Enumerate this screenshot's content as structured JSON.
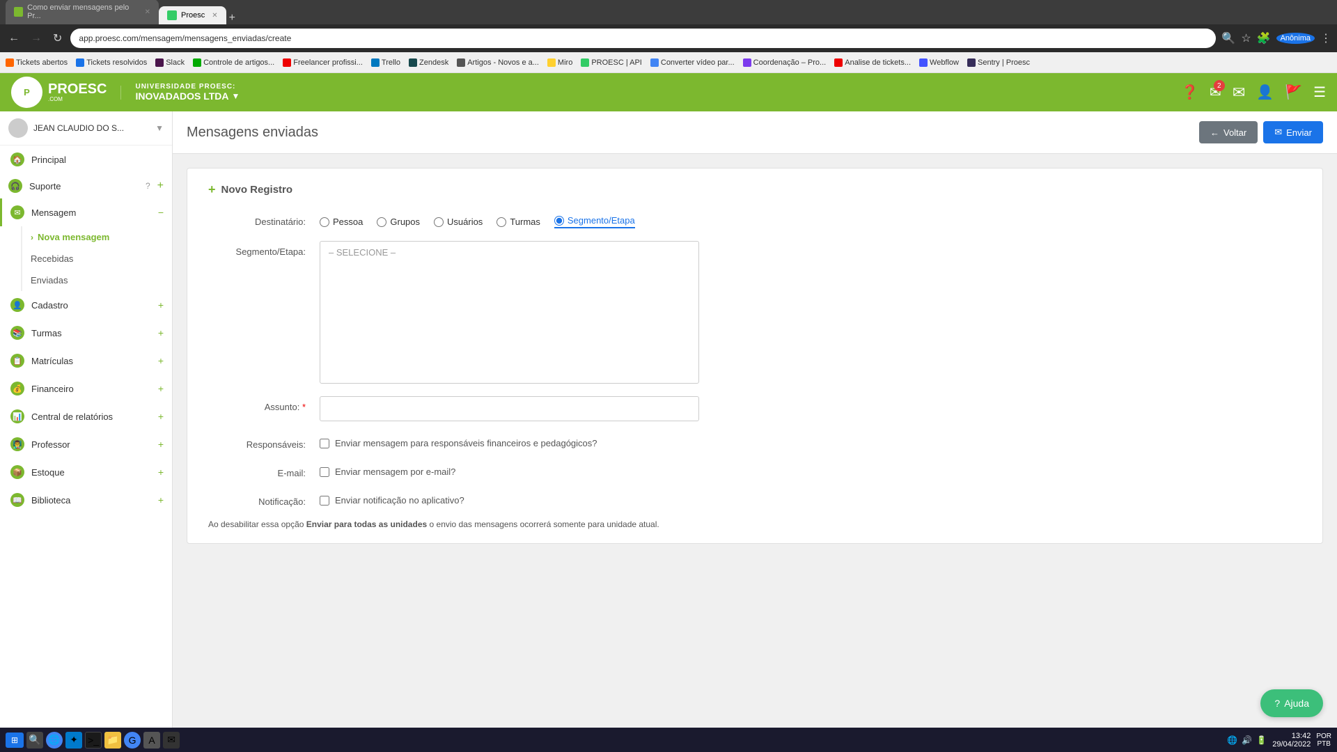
{
  "browser": {
    "tabs": [
      {
        "label": "Como enviar mensagens pelo Pr...",
        "favicon_color": "#7cb82f",
        "active": false
      },
      {
        "label": "Proesc",
        "favicon_color": "#3c6",
        "active": true
      }
    ],
    "url": "app.proesc.com/mensagem/mensagens_enviadas/create",
    "bookmarks": [
      {
        "label": "Tickets abertos",
        "color": "#f60"
      },
      {
        "label": "Tickets resolvidos",
        "color": "#1a73e8"
      },
      {
        "label": "Slack",
        "color": "#4a154b"
      },
      {
        "label": "Controle de artigos...",
        "color": "#0a0"
      },
      {
        "label": "Freelancer profissi...",
        "color": "#e00"
      },
      {
        "label": "Trello",
        "color": "#0079bf"
      },
      {
        "label": "Zendesk",
        "color": "#17494d"
      },
      {
        "label": "Artigos - Novos e a...",
        "color": "#555"
      },
      {
        "label": "Miro",
        "color": "#ffd02f"
      },
      {
        "label": "PROESC | API",
        "color": "#3c6"
      },
      {
        "label": "Converter vídeo par...",
        "color": "#4285f4"
      },
      {
        "label": "Coordenação – Pro...",
        "color": "#7c3aed"
      },
      {
        "label": "Analise de tickets...",
        "color": "#e00"
      },
      {
        "label": "Webflow",
        "color": "#4353ff"
      },
      {
        "label": "Sentry | Proesc",
        "color": "#362d59"
      }
    ]
  },
  "header": {
    "university_label": "UNIVERSIDADE PROESC:",
    "company_name": "INOVADADOS LTDA",
    "notification_count": "2"
  },
  "sidebar": {
    "user_name": "JEAN CLAUDIO DO S...",
    "items": [
      {
        "label": "Principal",
        "icon": "🏠"
      },
      {
        "label": "Suporte",
        "icon": "🎧",
        "expanded": false
      },
      {
        "label": "Mensagem",
        "icon": "✉",
        "expanded": true
      },
      {
        "label": "Cadastro",
        "icon": "👤",
        "expanded": false
      },
      {
        "label": "Turmas",
        "icon": "📚",
        "expanded": false
      },
      {
        "label": "Matrículas",
        "icon": "📋",
        "expanded": false
      },
      {
        "label": "Financeiro",
        "icon": "💰",
        "expanded": false
      },
      {
        "label": "Central de relatórios",
        "icon": "📊",
        "expanded": false
      },
      {
        "label": "Professor",
        "icon": "👨‍🏫",
        "expanded": false
      },
      {
        "label": "Estoque",
        "icon": "📦",
        "expanded": false
      },
      {
        "label": "Biblioteca",
        "icon": "📖",
        "expanded": false
      }
    ],
    "mensagem_submenu": [
      {
        "label": "Nova mensagem",
        "active": true
      },
      {
        "label": "Recebidas",
        "active": false
      },
      {
        "label": "Enviadas",
        "active": false
      }
    ]
  },
  "page": {
    "title": "Mensagens enviadas",
    "btn_back": "Voltar",
    "btn_send": "Enviar",
    "form_title": "Novo Registro",
    "destinatario_label": "Destinatário:",
    "destinatario_options": [
      {
        "label": "Pessoa",
        "value": "pessoa"
      },
      {
        "label": "Grupos",
        "value": "grupos"
      },
      {
        "label": "Usuários",
        "value": "usuarios"
      },
      {
        "label": "Turmas",
        "value": "turmas"
      },
      {
        "label": "Segmento/Etapa",
        "value": "segmento",
        "selected": true
      }
    ],
    "segmento_label": "Segmento/Etapa:",
    "segmento_placeholder": "– SELECIONE –",
    "assunto_label": "Assunto:",
    "responsaveis_label": "Responsáveis:",
    "responsaveis_checkbox": "Enviar mensagem para responsáveis financeiros e pedagógicos?",
    "email_label": "E-mail:",
    "email_checkbox": "Enviar mensagem por e-mail?",
    "notificacao_label": "Notificação:",
    "notificacao_checkbox": "Enviar notificação no aplicativo?",
    "footer_note_prefix": "Ao desabilitar essa opção ",
    "footer_note_bold": "Enviar para todas as unidades",
    "footer_note_suffix": " o envio das mensagens ocorrerá somente para unidade atual."
  },
  "ajuda": {
    "label": "Ajuda"
  },
  "taskbar": {
    "time": "13:42",
    "date": "29/04/2022",
    "locale": "POR\nPTB"
  }
}
